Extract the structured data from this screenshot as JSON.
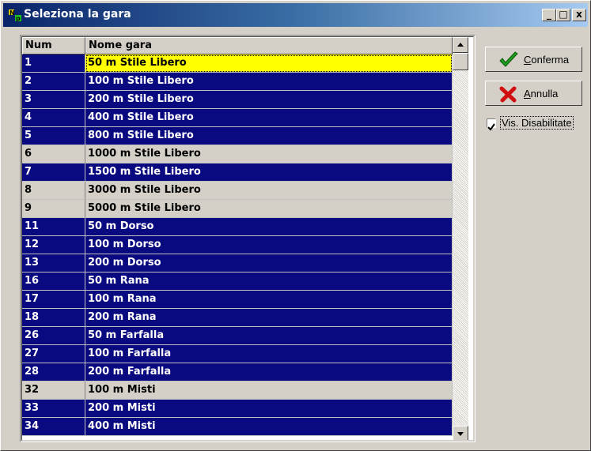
{
  "window": {
    "title": "Seleziona la gara",
    "controls": {
      "minimize": "_",
      "maximize": "□",
      "close": "x"
    }
  },
  "table": {
    "columns": [
      "Num",
      "Nome gara"
    ],
    "rows": [
      {
        "num": "1",
        "name": "50 m Stile Libero",
        "state": "selected"
      },
      {
        "num": "2",
        "name": "100 m Stile Libero",
        "state": "enabled"
      },
      {
        "num": "3",
        "name": "200 m Stile Libero",
        "state": "enabled"
      },
      {
        "num": "4",
        "name": "400 m Stile Libero",
        "state": "enabled"
      },
      {
        "num": "5",
        "name": "800 m Stile Libero",
        "state": "enabled"
      },
      {
        "num": "6",
        "name": "1000 m Stile Libero",
        "state": "disabled"
      },
      {
        "num": "7",
        "name": "1500 m Stile Libero",
        "state": "enabled"
      },
      {
        "num": "8",
        "name": "3000 m Stile Libero",
        "state": "disabled"
      },
      {
        "num": "9",
        "name": "5000 m Stile Libero",
        "state": "disabled"
      },
      {
        "num": "11",
        "name": "50 m Dorso",
        "state": "enabled"
      },
      {
        "num": "12",
        "name": "100 m Dorso",
        "state": "enabled"
      },
      {
        "num": "13",
        "name": "200 m Dorso",
        "state": "enabled"
      },
      {
        "num": "16",
        "name": "50 m Rana",
        "state": "enabled"
      },
      {
        "num": "17",
        "name": "100 m Rana",
        "state": "enabled"
      },
      {
        "num": "18",
        "name": "200 m Rana",
        "state": "enabled"
      },
      {
        "num": "26",
        "name": "50 m Farfalla",
        "state": "enabled"
      },
      {
        "num": "27",
        "name": "100 m Farfalla",
        "state": "enabled"
      },
      {
        "num": "28",
        "name": "200 m Farfalla",
        "state": "enabled"
      },
      {
        "num": "32",
        "name": "100 m Misti",
        "state": "disabled"
      },
      {
        "num": "33",
        "name": "200 m Misti",
        "state": "enabled"
      },
      {
        "num": "34",
        "name": "400 m Misti",
        "state": "enabled"
      }
    ]
  },
  "buttons": {
    "confirm": {
      "label": "Conferma",
      "icon": "checkmark-icon"
    },
    "cancel": {
      "label": "Annulla",
      "icon": "cross-icon"
    }
  },
  "show_disabled": {
    "label": "Vis. Disabilitate",
    "checked": true
  },
  "colors": {
    "enabled_row": "#0a0a80",
    "selected_row": "#ffff00",
    "disabled_row": "#d4d0c8",
    "titlebar": "#0a246a"
  }
}
